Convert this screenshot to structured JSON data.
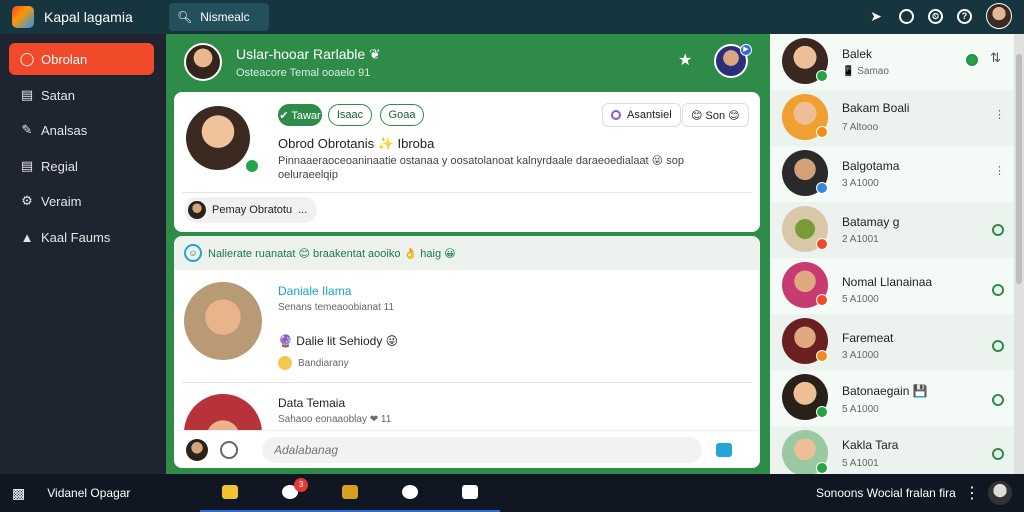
{
  "app": {
    "title": "Kapal lagamia"
  },
  "search": {
    "value": "Nismealc"
  },
  "sidebar": {
    "items": [
      {
        "label": "Obrolan",
        "icon": "chat-icon"
      },
      {
        "label": "Satan",
        "icon": "list-icon"
      },
      {
        "label": "Analsas",
        "icon": "pen-icon"
      },
      {
        "label": "Regial",
        "icon": "truck-icon"
      },
      {
        "label": "Veraim",
        "icon": "gear-icon"
      },
      {
        "label": "Kaal Faums",
        "icon": "bag-icon"
      }
    ]
  },
  "conversation": {
    "title": "Uslar-hooar Rarlable ❦",
    "subtitle": "Osteacore Temal ooaelo 91"
  },
  "profile": {
    "chips": [
      "✔ Tawar",
      "Isaac",
      "Goaa"
    ],
    "action1": "Asantsiel",
    "action2": "😊 Son 😊",
    "name": "Obrod Obrotanis ✨ Ibroba",
    "bio": "Pinnaaeraoceoaninaatie ostanaa y oosatolanoat kalnyrdaale daraeoedialaat 😜 sop oeluraeelqip",
    "reply_name": "Pemay Obratotu",
    "reply_more": "..."
  },
  "feed": {
    "banner": "Nalierate ruanatat 😊 braakentat aooiko 👌 haig 😀",
    "posts": [
      {
        "title": "Daniale Ilama",
        "time": "Senans temeaoobianat 11",
        "body": "🔮 Dalie lit Sehiody 😜",
        "extra": "Bandiarany"
      },
      {
        "title": "Data Temaia",
        "time": "Sahaoo eonaaoblay ❤ 11"
      }
    ],
    "composer_placeholder": "Adalabanag"
  },
  "contacts": [
    {
      "name": "Balek",
      "sub": "📱 Samao",
      "badge_color": "#23a445"
    },
    {
      "name": "Bakam Boali",
      "sub": "7 Altooo",
      "badge_color": "#f08c1a"
    },
    {
      "name": "Balgotama",
      "sub": "3 A1000",
      "badge_color": "#3b86e0"
    },
    {
      "name": "Batamay g",
      "sub": "2 A1001",
      "badge_color": "#f04a2a"
    },
    {
      "name": "Nomal Llanainaa",
      "sub": "5 A1000",
      "badge_color": "#f04a2a"
    },
    {
      "name": "Faremeat",
      "sub": "3 A1000",
      "badge_color": "#f08c1a"
    },
    {
      "name": "Batonaegain 💾",
      "sub": "5 A1000",
      "badge_color": "#23a445"
    },
    {
      "name": "Kakla Tara",
      "sub": "5 A1001",
      "badge_color": "#23a445"
    }
  ],
  "taskbar": {
    "label": "Vidanel Opagar",
    "badge": "3",
    "right_text": "Sonoons Wocial fralan fira"
  },
  "colors": {
    "accent": "#2e8b48",
    "active_nav": "#f04a2a",
    "topbar": "#17353f"
  }
}
